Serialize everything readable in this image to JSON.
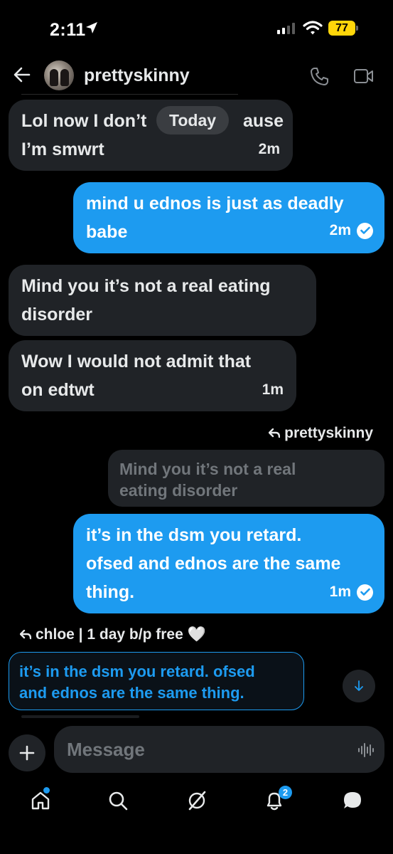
{
  "status_bar": {
    "time": "2:11",
    "battery": "77"
  },
  "header": {
    "title": "prettyskinny"
  },
  "date_divider": "Today",
  "messages": [
    {
      "line1": "Lol now I don’t",
      "line1_end": "ause",
      "line2": "I’m smwrt",
      "time": "2m"
    },
    {
      "line1": "mind u ednos is just as deadly",
      "line2": "babe",
      "time": "2m"
    },
    {
      "line1": "Mind you it’s not a real eating",
      "line2": "disorder"
    },
    {
      "line1": "Wow I would not admit that",
      "line2": "on edtwt",
      "time": "1m"
    },
    {
      "reply_to": "prettyskinny",
      "quoted_line1": "Mind you it’s not a real",
      "quoted_line2": "eating disorder",
      "line1": "it’s in the dsm you retard.",
      "line2": "ofsed and ednos are the same",
      "line3": "thing.",
      "time": "1m"
    }
  ],
  "replying": {
    "header": "chloe | 1 day b/p free 🤍",
    "line1": "it’s in the dsm you retard. ofsed",
    "line2": "and ednos are the same thing."
  },
  "composer": {
    "placeholder": "Message"
  },
  "nav": {
    "notifications_badge": "2"
  },
  "colors": {
    "accent": "#1d9bf0",
    "incoming_bubble": "#202327",
    "background": "#000000"
  }
}
